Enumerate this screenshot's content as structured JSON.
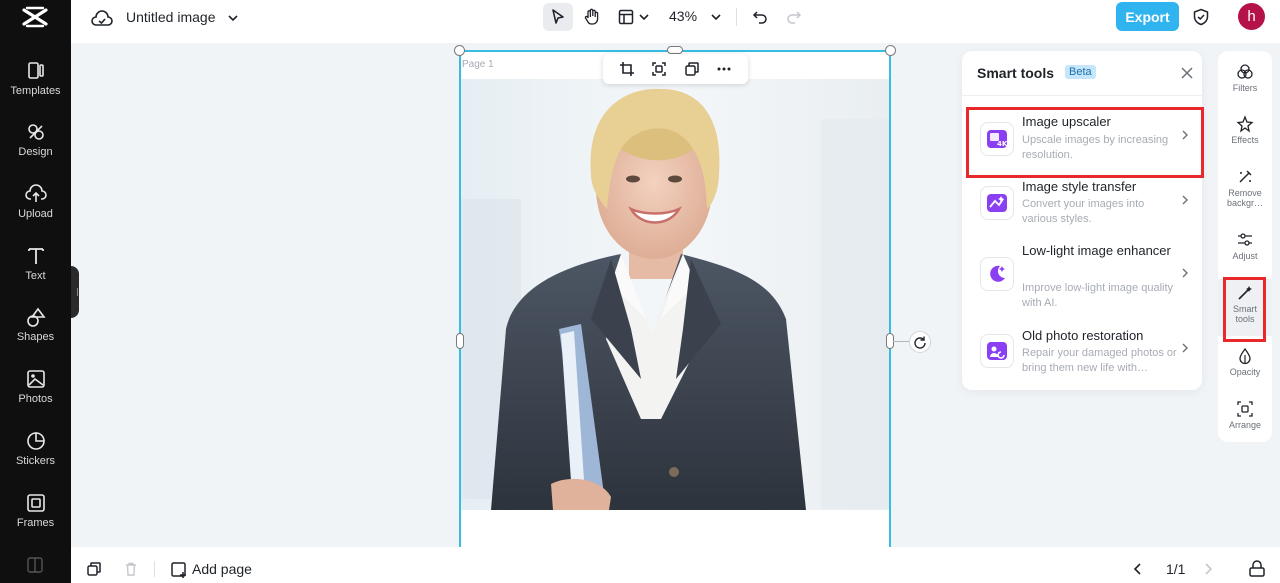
{
  "nav": {
    "items": [
      {
        "label": "Templates",
        "icon": "templates-icon"
      },
      {
        "label": "Design",
        "icon": "design-icon"
      },
      {
        "label": "Upload",
        "icon": "upload-icon"
      },
      {
        "label": "Text",
        "icon": "text-icon"
      },
      {
        "label": "Shapes",
        "icon": "shapes-icon"
      },
      {
        "label": "Photos",
        "icon": "photos-icon"
      },
      {
        "label": "Stickers",
        "icon": "stickers-icon"
      },
      {
        "label": "Frames",
        "icon": "frames-icon"
      }
    ]
  },
  "header": {
    "title": "Untitled image",
    "zoom": "43%",
    "export_label": "Export",
    "avatar_initial": "h",
    "accent": "#2fb4f0"
  },
  "canvas": {
    "page_label": "Page 1"
  },
  "panel": {
    "title": "Smart tools",
    "badge": "Beta",
    "tools": [
      {
        "name": "Image upscaler",
        "desc": "Upscale images by increasing resolution.",
        "icon": "image-4k-icon"
      },
      {
        "name": "Image style transfer",
        "desc": "Convert your images into various styles.",
        "icon": "style-transfer-icon"
      },
      {
        "name": "Low-light image enhancer",
        "desc": "Improve low-light image quality with AI.",
        "icon": "moon-enhance-icon"
      },
      {
        "name": "Old photo restoration",
        "desc": "Repair your damaged photos or bring them new life with…",
        "icon": "photo-restore-icon"
      }
    ]
  },
  "rightbar": {
    "items": [
      {
        "label": "Filters"
      },
      {
        "label": "Effects"
      },
      {
        "label": "Remove backgr…"
      },
      {
        "label": "Adjust"
      },
      {
        "label": "Smart tools"
      },
      {
        "label": "Opacity"
      },
      {
        "label": "Arrange"
      }
    ]
  },
  "footer": {
    "add_page_label": "Add page",
    "page_count": "1/1"
  }
}
